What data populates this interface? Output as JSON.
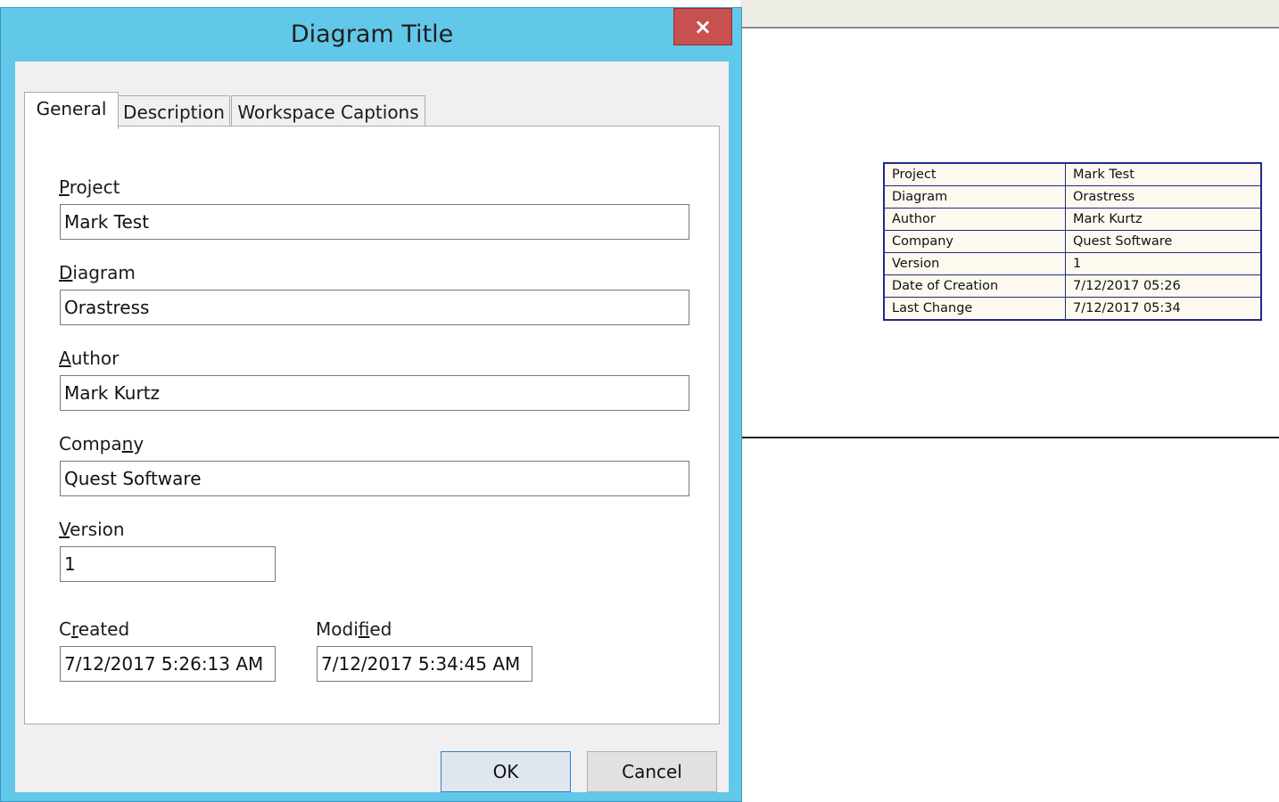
{
  "dialog": {
    "title": "Diagram Title",
    "close_label": "×",
    "tabs": [
      {
        "label": "General",
        "active": true
      },
      {
        "label": "Description",
        "active": false
      },
      {
        "label": "Workspace Captions",
        "active": false
      }
    ],
    "fields": {
      "project": {
        "label_pre": "",
        "label_accel": "P",
        "label_post": "roject",
        "value": "Mark Test"
      },
      "diagram": {
        "label_pre": "",
        "label_accel": "D",
        "label_post": "iagram",
        "value": "Orastress"
      },
      "author": {
        "label_pre": "",
        "label_accel": "A",
        "label_post": "uthor",
        "value": "Mark Kurtz"
      },
      "company": {
        "label_pre": "Compa",
        "label_accel": "n",
        "label_post": "y",
        "value": "Quest Software"
      },
      "version": {
        "label_pre": "",
        "label_accel": "V",
        "label_post": "ersion",
        "value": "1"
      },
      "created": {
        "label_pre": "C",
        "label_accel": "r",
        "label_post": "eated",
        "value": "7/12/2017 5:26:13 AM"
      },
      "modified": {
        "label_pre": "Modi",
        "label_accel": "f",
        "label_post": "ied",
        "value": "7/12/2017 5:34:45 AM"
      }
    },
    "buttons": {
      "ok": "OK",
      "cancel": "Cancel"
    },
    "colors": {
      "frame": "#62c8e9",
      "close": "#c75050"
    }
  },
  "diagram_title_block": {
    "rows": [
      {
        "key": "Project",
        "value": "Mark Test"
      },
      {
        "key": "Diagram",
        "value": "Orastress"
      },
      {
        "key": "Author",
        "value": "Mark Kurtz"
      },
      {
        "key": "Company",
        "value": "Quest Software"
      },
      {
        "key": "Version",
        "value": "1"
      },
      {
        "key": "Date of Creation",
        "value": "7/12/2017 05:26"
      },
      {
        "key": "Last Change",
        "value": "7/12/2017 05:34"
      }
    ],
    "colors": {
      "border": "#1f2a8c",
      "fill": "#fdf9ee"
    }
  }
}
